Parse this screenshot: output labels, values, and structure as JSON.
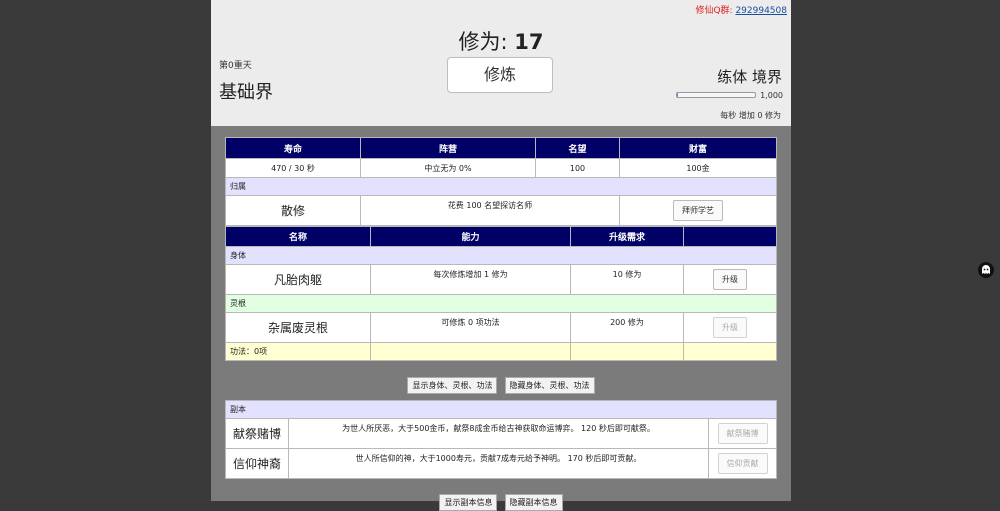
{
  "qq": {
    "label": "修仙Q群:",
    "number": "292994508"
  },
  "cultivation": {
    "label": "修为:",
    "value": "17",
    "button": "修炼"
  },
  "realm": {
    "heaven": "第0重天",
    "name": "基础界",
    "stage": "练体 境界",
    "bar_max": "1,000",
    "bar_progress": 0.017,
    "per_second": "每秒 增加 0 修为"
  },
  "stats": {
    "headers": [
      "寿命",
      "阵营",
      "名望",
      "财富"
    ],
    "values": [
      "470 / 30 秒",
      "中立无为 0%",
      "100",
      "100金"
    ]
  },
  "affiliation": {
    "section": "归属",
    "name": "散修",
    "desc": "花费 100 名望探访名师",
    "button": "拜师学艺"
  },
  "abilities": {
    "headers": [
      "名称",
      "能力",
      "升级需求"
    ],
    "body_section": "身体",
    "body": {
      "name": "凡胎肉躯",
      "ability": "每次修炼增加 1 修为",
      "req": "10 修为",
      "button": "升级"
    },
    "root_section": "灵根",
    "root": {
      "name": "杂属废灵根",
      "ability": "可修炼 0 项功法",
      "req": "200 修为",
      "button": "升级"
    },
    "techniques": "功法：0项"
  },
  "toggles": {
    "show": "显示身体、灵根、功法",
    "hide": "隐藏身体、灵根、功法"
  },
  "dungeon": {
    "section": "副本",
    "items": [
      {
        "name": "献祭赌博",
        "desc": "为世人所厌恶，大于500金币，献祭8成金币给古神获取命运博弈。 120 秒后即可献祭。",
        "button": "献祭赌博"
      },
      {
        "name": "信仰神裔",
        "desc": "世人所信仰的神，大于1000寿元，贡献7成寿元给予神明。 170 秒后即可贡献。",
        "button": "信仰贡献"
      }
    ]
  },
  "dungeon_toggles": {
    "show": "显示副本信息",
    "hide": "隐藏副本信息"
  },
  "colors": {
    "header_bg": "#000066",
    "section_blue": "#e2e2ff",
    "section_green": "#e2ffe2",
    "section_yellow": "#ffffd2"
  }
}
